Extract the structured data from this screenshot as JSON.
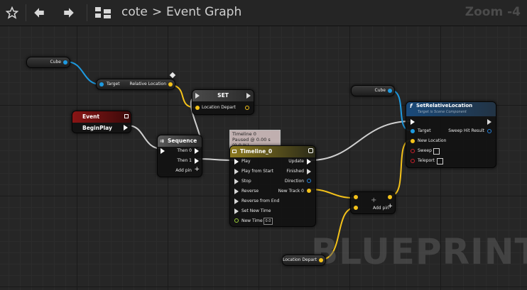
{
  "toolbar": {
    "favorite_icon": "star-icon",
    "back_icon": "back-arrow-icon",
    "forward_icon": "forward-arrow-icon",
    "graph_icon": "blueprint-graph-icon",
    "crumb_root": "cote",
    "crumb_separator": ">",
    "crumb_current": "Event Graph",
    "zoom": "Zoom -4"
  },
  "watermark": "BLUEPRINT",
  "nodes": {
    "cube_top": {
      "label": "Cube"
    },
    "cube_right": {
      "label": "Cube"
    },
    "relative_location": {
      "target": "Target",
      "output": "Relative Location"
    },
    "set_node": {
      "title": "SET",
      "pin": "Location Depart"
    },
    "event_begin_play": {
      "title": "Event BeginPlay"
    },
    "sequence": {
      "title": "Sequence",
      "then0": "Then 0",
      "then1": "Then 1",
      "add_pin": "Add pin"
    },
    "timeline_comment": {
      "line1": "Timeline 0",
      "line2": "Paused @ 0.00 s (0.0 %)"
    },
    "timeline": {
      "title": "Timeline_0",
      "inputs": [
        "Play",
        "Play from Start",
        "Stop",
        "Reverse",
        "Reverse from End",
        "Set New Time",
        "New Time"
      ],
      "outputs": [
        "Update",
        "Finished",
        "Direction",
        "New Track 0"
      ],
      "new_time_value": "0.0"
    },
    "add_node": {
      "symbol": "+",
      "add_pin": "Add pin"
    },
    "set_relative_location": {
      "title": "SetRelativeLocation",
      "subtitle": "Target is Scene Component",
      "target": "Target",
      "sweep_hit_result": "Sweep Hit Result",
      "new_location": "New Location",
      "sweep": "Sweep",
      "teleport": "Teleport"
    },
    "location_depart_get": {
      "label": "Location Depart"
    }
  }
}
